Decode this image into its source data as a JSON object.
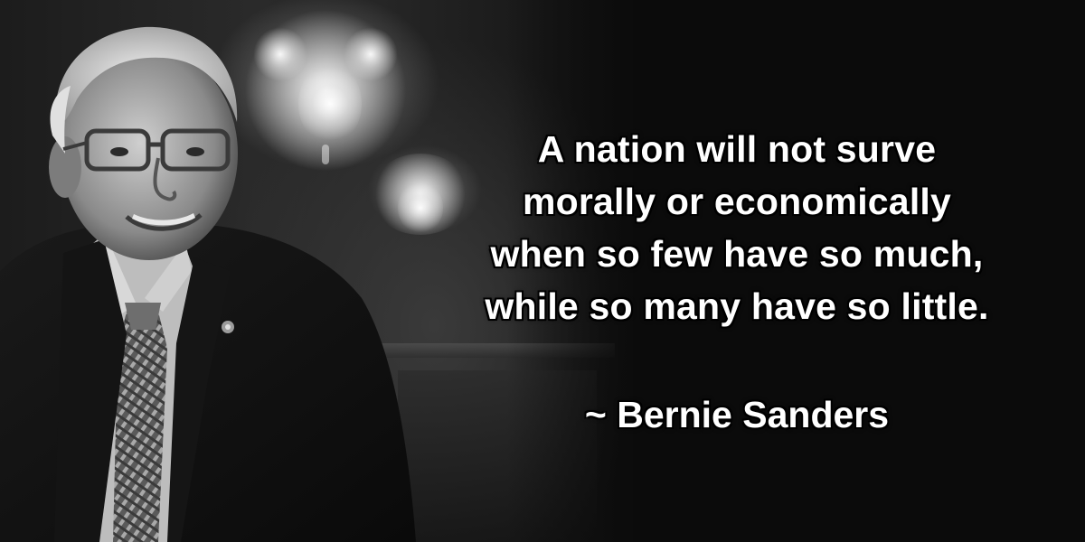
{
  "quote": {
    "lines": [
      "A nation will not surve",
      "morally or economically",
      "when so few have so much,",
      "while so many have so little."
    ],
    "attribution": "~ Bernie Sanders"
  },
  "image": {
    "subject": "portrait-photo",
    "style": "black-and-white"
  },
  "colors": {
    "text": "#ffffff",
    "text_outline": "#000000",
    "background": "#0b0b0b"
  }
}
